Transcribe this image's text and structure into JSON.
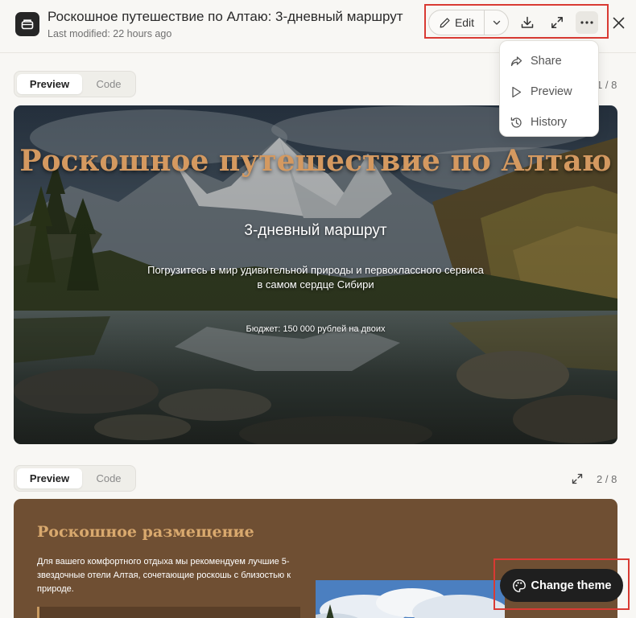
{
  "header": {
    "title": "Роскошное путешествие по Алтаю: 3-дневный маршрут",
    "last_modified": "Last modified: 22 hours ago",
    "edit_label": "Edit"
  },
  "menu": {
    "items": [
      {
        "label": "Share",
        "icon": "share-icon"
      },
      {
        "label": "Preview",
        "icon": "play-icon"
      },
      {
        "label": "History",
        "icon": "history-icon"
      }
    ]
  },
  "slides": [
    {
      "tabs": {
        "preview": "Preview",
        "code": "Code"
      },
      "page": "1 / 8",
      "title": "Роскошное путешествие по Алтаю",
      "subtitle": "3-дневный маршрут",
      "description": "Погрузитесь в мир удивительной природы и первоклассного сервиса в самом сердце Сибири",
      "budget": "Бюджет: 150 000 рублей на двоих"
    },
    {
      "tabs": {
        "preview": "Preview",
        "code": "Code"
      },
      "page": "2 / 8",
      "title": "Роскошное размещение",
      "text": "Для вашего комфортного отдыха мы рекомендуем лучшие 5-звездочные отели Алтая, сочетающие роскошь с близостью к природе."
    }
  ],
  "theme_button": {
    "label": "Change theme"
  },
  "colors": {
    "accent_red": "#d93a33",
    "slide_title": "#d49960",
    "slide2_bg": "#6f4f33"
  }
}
